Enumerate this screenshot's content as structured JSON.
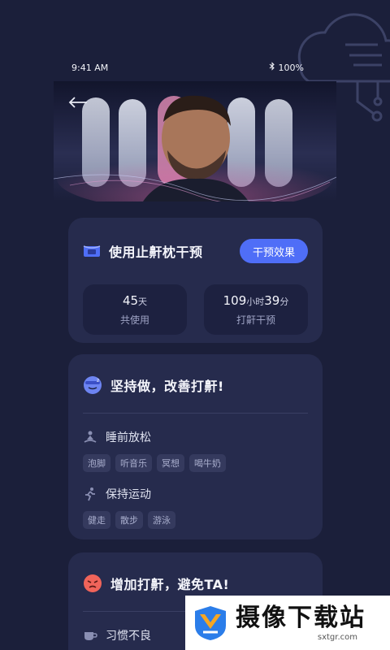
{
  "status_bar": {
    "time": "9:41 AM",
    "battery": "100%"
  },
  "intervention_card": {
    "title": "使用止鼾枕干预",
    "effect_button": "干预效果",
    "stats": [
      {
        "value": "45",
        "unit": "天",
        "label": "共使用"
      },
      {
        "value": "109",
        "unit1": "小时",
        "value2": "39",
        "unit2": "分",
        "label": "打鼾干预"
      }
    ]
  },
  "keep_card": {
    "title": "坚持做，改善打鼾!",
    "sections": [
      {
        "title": "睡前放松",
        "icon": "meditation-icon",
        "tags": [
          "泡脚",
          "听音乐",
          "冥想",
          "喝牛奶"
        ]
      },
      {
        "title": "保持运动",
        "icon": "running-icon",
        "tags": [
          "健走",
          "散步",
          "游泳"
        ]
      }
    ]
  },
  "avoid_card": {
    "title": "增加打鼾，避免TA!",
    "sections": [
      {
        "title": "习惯不良",
        "icon": "cup-icon"
      }
    ]
  },
  "watermark": {
    "title": "摄像下载站",
    "url": "sxtgr.com"
  },
  "colors": {
    "background": "#1b1f3a",
    "card": "#262b4d",
    "accent": "#4f6ef7"
  }
}
